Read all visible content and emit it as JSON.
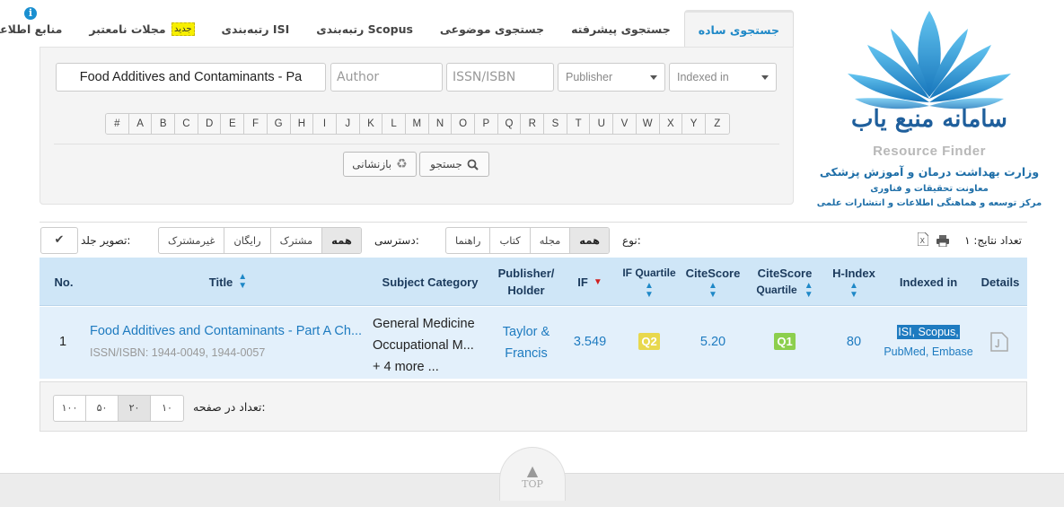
{
  "tabs": [
    {
      "label": "جستجوی ساده",
      "active": true
    },
    {
      "label": "جستجوی پیشرفته"
    },
    {
      "label": "جستجوی موضوعی"
    },
    {
      "label": "رتبه‌بندی Scopus"
    },
    {
      "label": "رتبه‌بندی ISI"
    },
    {
      "label": "مجلات نامعتبر",
      "badge": "جدید"
    },
    {
      "label": "منابع اطلاعاتی"
    }
  ],
  "search": {
    "title_value": "Food Additives and Contaminants - Pa",
    "author_placeholder": "Author",
    "issn_placeholder": "ISSN/ISBN",
    "publisher_label": "Publisher",
    "indexed_label": "Indexed in",
    "letters": [
      "#",
      "A",
      "B",
      "C",
      "D",
      "E",
      "F",
      "G",
      "H",
      "I",
      "J",
      "K",
      "L",
      "M",
      "N",
      "O",
      "P",
      "Q",
      "R",
      "S",
      "T",
      "U",
      "V",
      "W",
      "X",
      "Y",
      "Z"
    ],
    "search_button": "جستجو",
    "reset_button": "بازنشانی"
  },
  "logo": {
    "script_title": "سامانه منبع یاب",
    "latin_title": "Resource Finder",
    "ministry": "وزارت بهداشت درمان و آموزش پزشکی",
    "deputy": "معاونت تحقیقات و فناوری",
    "center": "مرکز توسعه و هماهنگی اطلاعات و انتشارات علمی",
    "colors": {
      "petal_dark": "#0b6fb8",
      "petal_light": "#5cc2f0",
      "text_blue": "#1f6fa8"
    }
  },
  "filters": {
    "result_count_label": "تعداد نتایج: ۱",
    "type_label": "نوع:",
    "type_options": [
      "همه",
      "مجله",
      "کتاب",
      "راهنما"
    ],
    "type_selected": "همه",
    "access_label": "دسترسی:",
    "access_options": [
      "همه",
      "مشترک",
      "رایگان",
      "غیرمشترک"
    ],
    "access_selected": "همه",
    "cover_label": "تصویر جلد:"
  },
  "table": {
    "headers": {
      "details": "Details",
      "indexed": "Indexed in",
      "hindex": "H-Index",
      "cs_quartile_1": "CiteScore",
      "cs_quartile_2": "Quartile",
      "citescore": "CiteScore",
      "if_quartile": "IF Quartile",
      "if": "IF",
      "publisher_1": "Publisher/",
      "publisher_2": "Holder",
      "subject": "Subject Category",
      "title": "Title",
      "no": "No."
    },
    "rows": [
      {
        "no": "1",
        "title": "Food Additives and Contaminants - Part A Ch...",
        "issn": "ISSN/ISBN: 1944-0049, 1944-0057",
        "subject_1": "General Medicine",
        "subject_2": "Occupational M...",
        "subject_more": "+ 4 more ...",
        "publisher_1": "Taylor &",
        "publisher_2": "Francis",
        "if": "3.549",
        "if_quartile": "Q2",
        "citescore": "5.20",
        "cs_quartile": "Q1",
        "hindex": "80",
        "indexed_1": "ISI, Scopus,",
        "indexed_2": "PubMed, Embase"
      }
    ]
  },
  "pager": {
    "label": "تعداد در صفحه:",
    "sizes": [
      "۱۰",
      "۲۰",
      "۵۰",
      "۱۰۰"
    ],
    "selected": "۲۰"
  },
  "top_label": "TOP"
}
